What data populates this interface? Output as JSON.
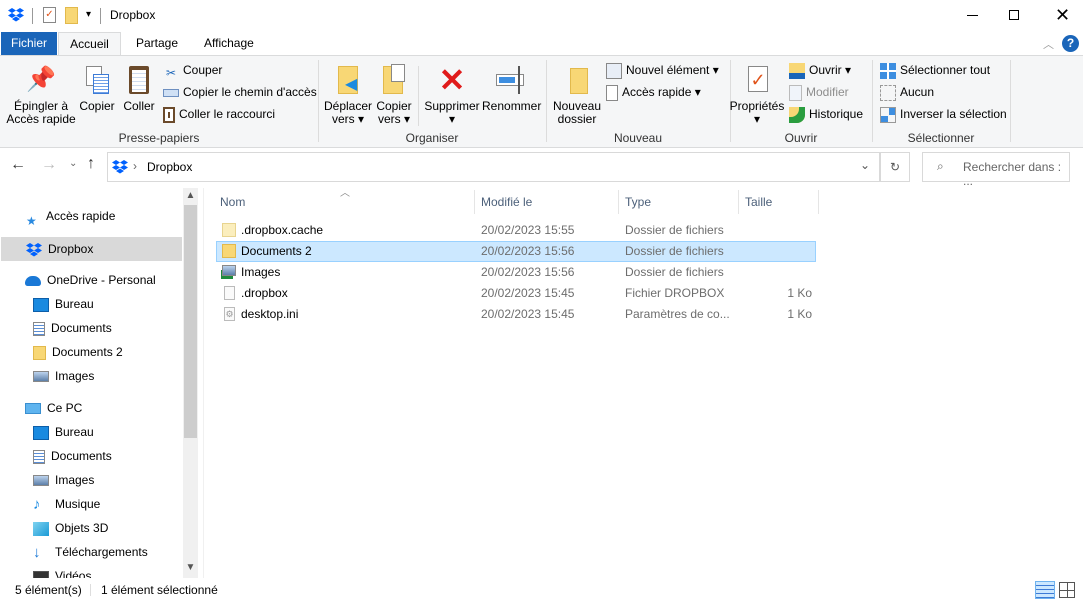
{
  "window": {
    "title": "Dropbox"
  },
  "tabs": [
    {
      "label": "Fichier"
    },
    {
      "label": "Accueil"
    },
    {
      "label": "Partage"
    },
    {
      "label": "Affichage"
    }
  ],
  "ribbon": {
    "presse_papiers": {
      "label": "Presse-papiers",
      "pin": "Épingler à Accès rapide",
      "pin1": "Épingler à",
      "pin2": "Accès rapide",
      "copy": "Copier",
      "paste": "Coller",
      "cut": "Couper",
      "copy_path": "Copier le chemin d'accès",
      "paste_shortcut": "Coller le raccourci"
    },
    "organiser": {
      "label": "Organiser",
      "move1": "Déplacer",
      "move2": "vers",
      "copy1": "Copier",
      "copy2": "vers",
      "delete": "Supprimer",
      "rename": "Renommer"
    },
    "nouveau": {
      "label": "Nouveau",
      "new_folder1": "Nouveau",
      "new_folder2": "dossier",
      "new_item": "Nouvel élément",
      "easy_access": "Accès rapide"
    },
    "ouvrir": {
      "label": "Ouvrir",
      "properties": "Propriétés",
      "open": "Ouvrir",
      "edit": "Modifier",
      "history": "Historique"
    },
    "selectionner": {
      "label": "Sélectionner",
      "select_all": "Sélectionner tout",
      "none": "Aucun",
      "invert": "Inverser la sélection"
    }
  },
  "address": {
    "path": "Dropbox",
    "search_placeholder": "Rechercher dans : ..."
  },
  "sidebar": {
    "items": [
      {
        "label": "Accès rapide",
        "icon": "star-icon"
      },
      {
        "label": "Dropbox",
        "icon": "dropbox-icon",
        "selected": true
      },
      {
        "label": "OneDrive - Personal",
        "icon": "cloud-icon"
      },
      {
        "label": "Bureau",
        "icon": "desktop-icon"
      },
      {
        "label": "Documents",
        "icon": "document-icon"
      },
      {
        "label": "Documents 2",
        "icon": "folder-icon"
      },
      {
        "label": "Images",
        "icon": "pictures-icon"
      },
      {
        "label": "Ce PC",
        "icon": "computer-icon"
      },
      {
        "label": "Bureau",
        "icon": "desktop-icon"
      },
      {
        "label": "Documents",
        "icon": "document-icon"
      },
      {
        "label": "Images",
        "icon": "pictures-icon"
      },
      {
        "label": "Musique",
        "icon": "music-icon"
      },
      {
        "label": "Objets 3D",
        "icon": "cube-icon"
      },
      {
        "label": "Téléchargements",
        "icon": "download-icon"
      },
      {
        "label": "Vidéos",
        "icon": "video-icon"
      }
    ]
  },
  "columns": {
    "name": "Nom",
    "modified": "Modifié le",
    "type": "Type",
    "size": "Taille"
  },
  "files": [
    {
      "name": ".dropbox.cache",
      "modified": "20/02/2023 15:55",
      "type": "Dossier de fichiers",
      "size": ""
    },
    {
      "name": "Documents 2",
      "modified": "20/02/2023 15:56",
      "type": "Dossier de fichiers",
      "size": "",
      "selected": true
    },
    {
      "name": "Images",
      "modified": "20/02/2023 15:56",
      "type": "Dossier de fichiers",
      "size": ""
    },
    {
      "name": ".dropbox",
      "modified": "20/02/2023 15:45",
      "type": "Fichier DROPBOX",
      "size": "1 Ko"
    },
    {
      "name": "desktop.ini",
      "modified": "20/02/2023 15:45",
      "type": "Paramètres de co...",
      "size": "1 Ko"
    }
  ],
  "status": {
    "count": "5 élément(s)",
    "selected": "1 élément sélectionné"
  },
  "colors": {
    "accent": "#1a65b9",
    "selection": "#cce8ff",
    "dropbox": "#0061fe"
  }
}
